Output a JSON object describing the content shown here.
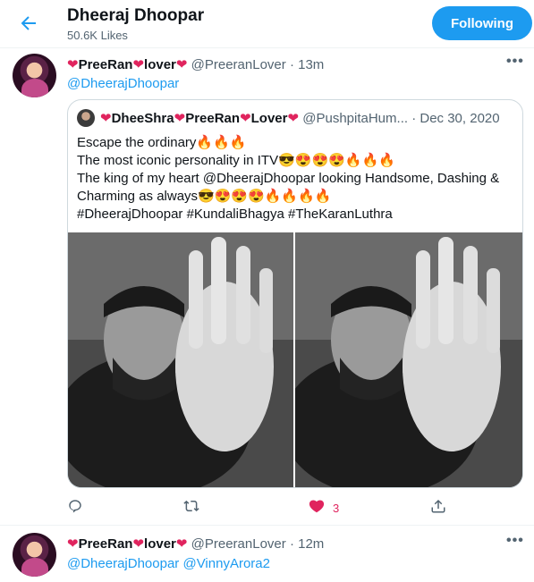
{
  "header": {
    "title": "Dheeraj Dhoopar",
    "subtitle": "50.6K Likes",
    "follow_label": "Following"
  },
  "tweets": [
    {
      "display_name": "PreeRan",
      "display_suffix": "lover",
      "handle": "@PreeranLover",
      "time": "· 13m",
      "reply_to": "@DheerajDhoopar",
      "quote": {
        "name_a": "DheeShra",
        "name_b": "PreeRan",
        "name_c": "Lover",
        "handle": "@PushpitaHum...",
        "date": "· Dec 30, 2020",
        "lines": [
          "Escape the ordinary🔥🔥🔥",
          "The most iconic personality in ITV😎😍😍😍🔥🔥🔥",
          "The king of my heart @DheerajDhoopar looking Handsome, Dashing &",
          "Charming as always😎😍😍😍🔥🔥🔥🔥",
          "#DheerajDhoopar #KundaliBhagya #TheKaranLuthra"
        ]
      },
      "likes": "3"
    },
    {
      "display_name": "PreeRan",
      "display_suffix": "lover",
      "handle": "@PreeranLover",
      "time": "· 12m",
      "reply_to": "@DheerajDhoopar @VinnyArora2"
    }
  ],
  "icons": {
    "more": "•••",
    "heart": "❤"
  },
  "colors": {
    "accent": "#1d9bf0",
    "like": "#e0245e",
    "muted": "#536471"
  }
}
